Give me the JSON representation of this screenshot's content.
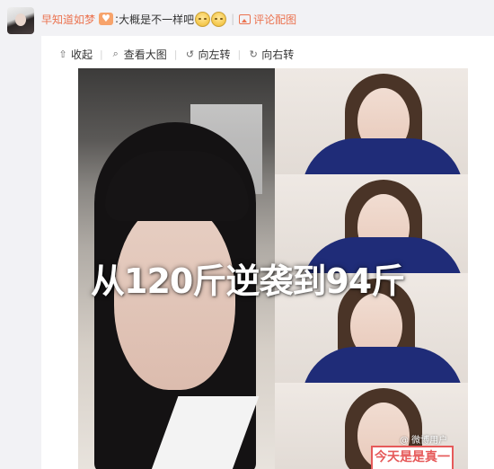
{
  "comment": {
    "username": "早知道如梦",
    "colon": ":",
    "text": "大概是不一样吧",
    "emoji_icon": "dizzy-face-emoji",
    "emoji_count": 2,
    "separator": "|",
    "reply_with_image": "评论配图",
    "accent_color": "#eb7350"
  },
  "toolbar": {
    "items": [
      {
        "icon": "arrow-up-icon",
        "glyph": "⇧",
        "label": "收起"
      },
      {
        "icon": "magnifier-icon",
        "glyph": "⌕",
        "label": "查看大图"
      },
      {
        "icon": "rotate-left-icon",
        "glyph": "↺",
        "label": "向左转"
      },
      {
        "icon": "rotate-right-icon",
        "glyph": "↻",
        "label": "向右转"
      }
    ]
  },
  "image": {
    "overlay_text": "从120斤逆袭到94斤",
    "corner_text": "今天是是真一",
    "watermark": "@ 微博用户"
  }
}
